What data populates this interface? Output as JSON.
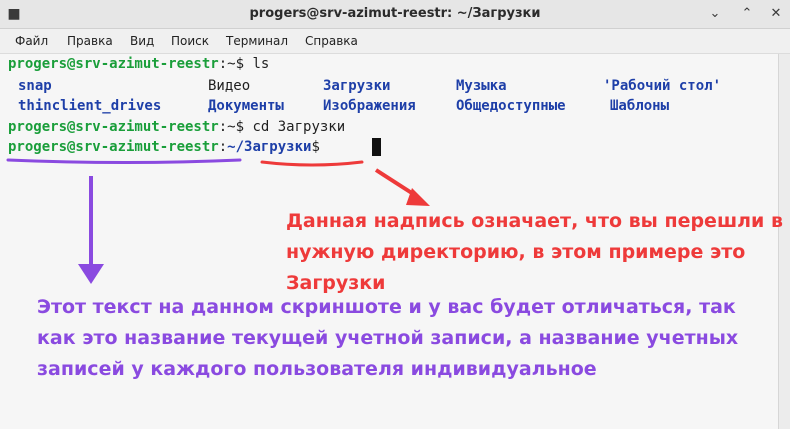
{
  "window": {
    "title": "progers@srv-azimut-reestr: ~/Загрузки",
    "menu_icon": "■",
    "minimize_icon": "⌄",
    "maximize_icon": "⌃",
    "close_icon": "✕"
  },
  "menu": [
    "Файл",
    "Правка",
    "Вид",
    "Поиск",
    "Терминал",
    "Справка"
  ],
  "terminal": {
    "user": "progers@srv-azimut-reestr",
    "home_suffix": ":~$",
    "cmd1": " ls",
    "cmd2": " cd Загрузки",
    "path_sep": ":",
    "path": "~/Загрузки",
    "prompt_end": "$",
    "ls_row1": [
      "snap",
      "Видео",
      "Загрузки",
      "Музыка",
      "'Рабочий стол'"
    ],
    "ls_row2": [
      "thinclient_drives",
      "Документы",
      "Изображения",
      "Общедоступные",
      "Шаблоны"
    ]
  },
  "annotations": {
    "red": "Данная надпись означает, что вы перешли в нужную директорию, в этом примере это Загрузки",
    "purple": "Этот текст на данном скриншоте и у вас будет отличаться, так как это название текущей учетной записи, а название учетных записей у каждого пользователя индивидуальное"
  },
  "colors": {
    "user": "#1a9e3a",
    "path": "#1e3fa8",
    "red_annotation": "#ee3a3a",
    "purple_annotation": "#8a4ae0"
  }
}
